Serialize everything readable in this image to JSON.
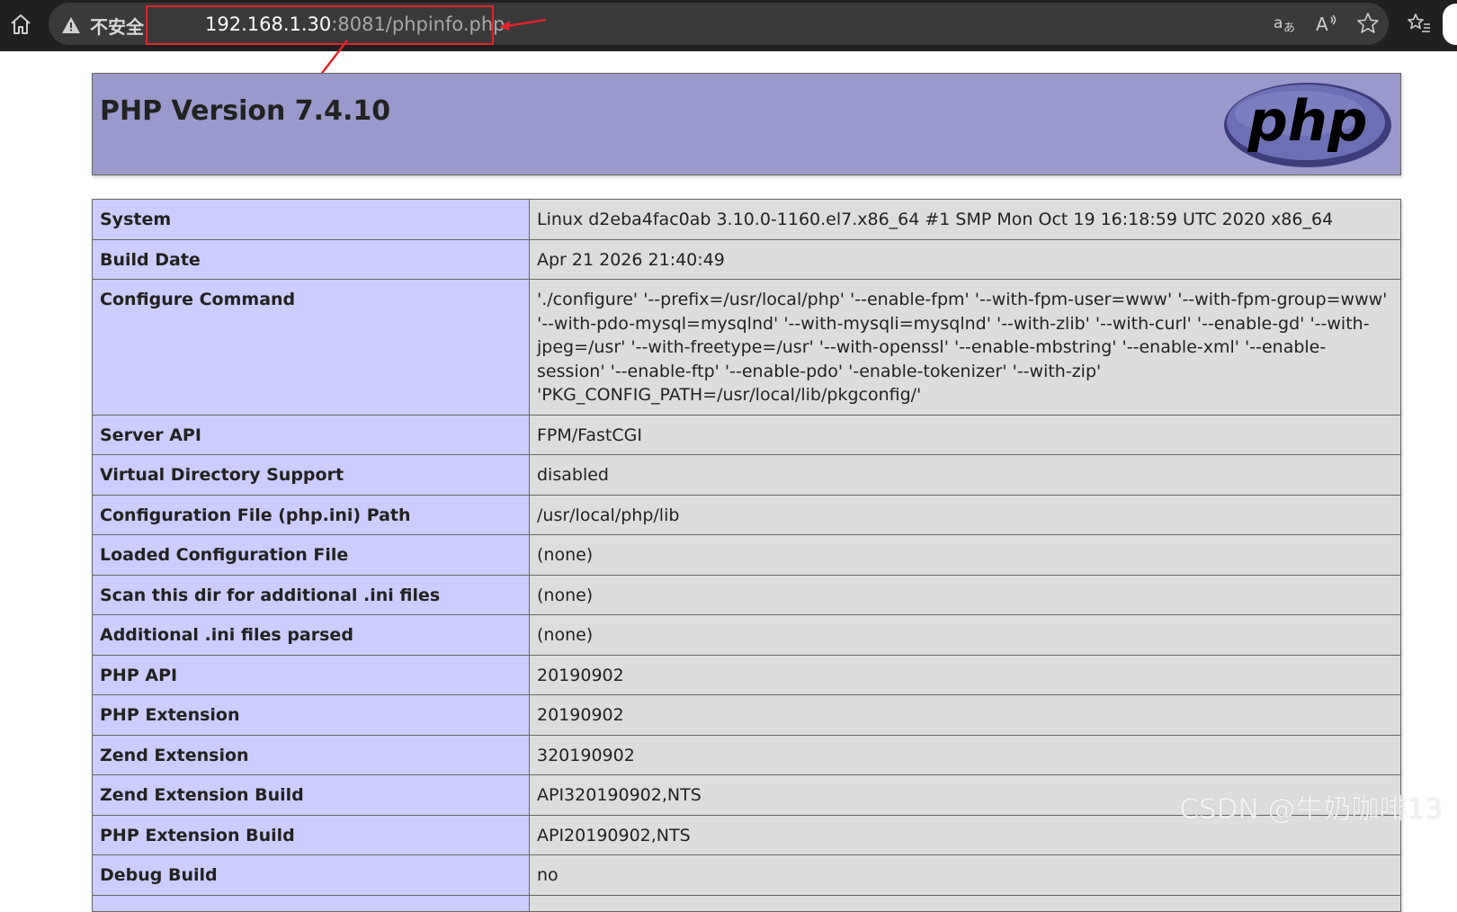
{
  "browser": {
    "insecure_label": "不安全",
    "url_host": "192.168.1.30",
    "url_rest": ":8081/phpinfo.php",
    "icons": [
      "home-icon",
      "warning-icon",
      "translate-icon",
      "read-aloud-icon",
      "favorite-star-icon",
      "favorites-list-icon"
    ]
  },
  "header": {
    "title": "PHP Version 7.4.10",
    "logo_text": "php",
    "background": "#9999cc"
  },
  "colors": {
    "label_cell": "#ccccff",
    "value_cell": "#dddddd",
    "annotation": "#e0252a"
  },
  "rows": [
    {
      "label": "System",
      "value": "Linux d2eba4fac0ab 3.10.0-1160.el7.x86_64 #1 SMP Mon Oct 19 16:18:59 UTC 2020 x86_64"
    },
    {
      "label": "Build Date",
      "value": "Apr 21 2026 21:40:49"
    },
    {
      "label": "Configure Command",
      "value": "'./configure' '--prefix=/usr/local/php' '--enable-fpm' '--with-fpm-user=www' '--with-fpm-group=www' '--with-pdo-mysql=mysqlnd' '--with-mysqli=mysqlnd' '--with-zlib' '--with-curl' '--enable-gd' '--with-jpeg=/usr' '--with-freetype=/usr' '--with-openssl' '--enable-mbstring' '--enable-xml' '--enable-session' '--enable-ftp' '--enable-pdo' '-enable-tokenizer' '--with-zip' 'PKG_CONFIG_PATH=/usr/local/lib/pkgconfig/'"
    },
    {
      "label": "Server API",
      "value": "FPM/FastCGI"
    },
    {
      "label": "Virtual Directory Support",
      "value": "disabled"
    },
    {
      "label": "Configuration File (php.ini) Path",
      "value": "/usr/local/php/lib"
    },
    {
      "label": "Loaded Configuration File",
      "value": "(none)"
    },
    {
      "label": "Scan this dir for additional .ini files",
      "value": "(none)"
    },
    {
      "label": "Additional .ini files parsed",
      "value": "(none)"
    },
    {
      "label": "PHP API",
      "value": "20190902"
    },
    {
      "label": "PHP Extension",
      "value": "20190902"
    },
    {
      "label": "Zend Extension",
      "value": "320190902"
    },
    {
      "label": "Zend Extension Build",
      "value": "API320190902,NTS"
    },
    {
      "label": "PHP Extension Build",
      "value": "API20190902,NTS"
    },
    {
      "label": "Debug Build",
      "value": "no"
    },
    {
      "label": "",
      "value": ""
    }
  ],
  "watermark": "CSDN @牛奶咖啡13"
}
